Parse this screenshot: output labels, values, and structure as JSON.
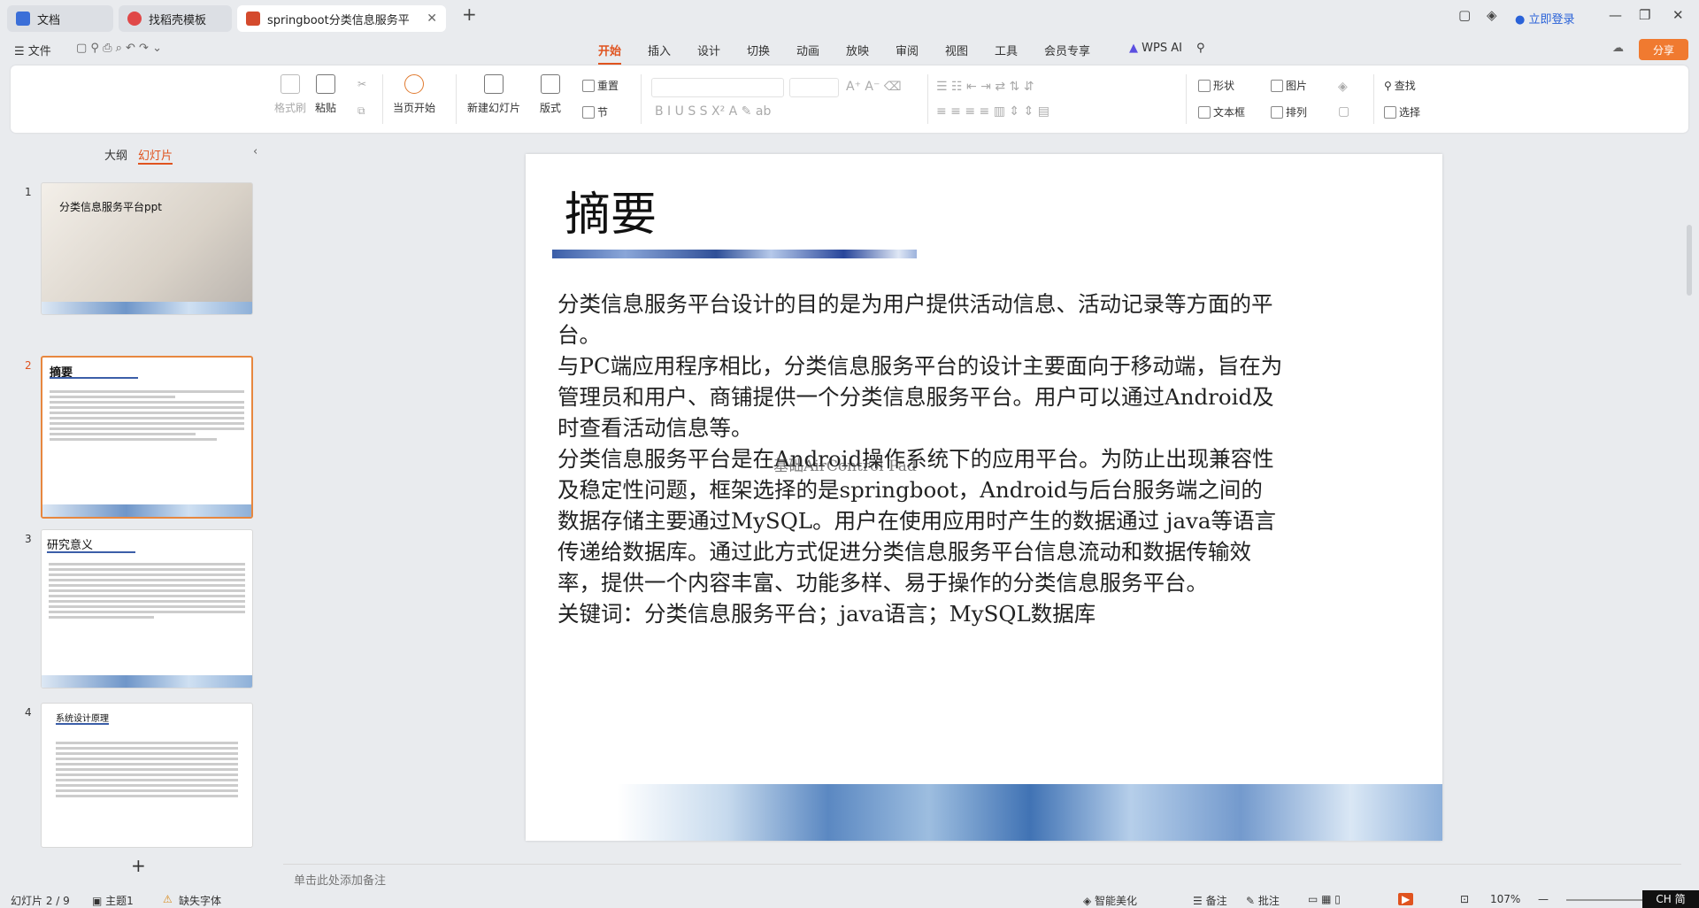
{
  "tabs": [
    {
      "label": "文档",
      "icon": "doc-icon"
    },
    {
      "label": "找稻壳模板",
      "icon": "template-icon"
    },
    {
      "label": "springboot分类信息服务平",
      "icon": "ppt-icon"
    }
  ],
  "window": {
    "login": "立即登录"
  },
  "menu": {
    "file": "文件",
    "items": [
      "开始",
      "插入",
      "设计",
      "切换",
      "动画",
      "放映",
      "审阅",
      "视图",
      "工具",
      "会员专享"
    ],
    "wps_ai": "WPS AI",
    "share": "分享"
  },
  "ribbon": {
    "format_painter": "格式刷",
    "paste": "粘贴",
    "start_show": "当页开始",
    "new_slide": "新建幻灯片",
    "layout": "版式",
    "reset": "重置",
    "section": "节",
    "shape": "形状",
    "picture": "图片",
    "find": "查找",
    "textbox": "文本框",
    "arrange": "排列",
    "select": "选择"
  },
  "panel": {
    "outline": "大纲",
    "slides": "幻灯片"
  },
  "thumbs": [
    {
      "num": "1",
      "title": "分类信息服务平台ppt"
    },
    {
      "num": "2",
      "title": "摘要"
    },
    {
      "num": "3",
      "title": "研究意义"
    },
    {
      "num": "4",
      "title": "系统设计原理"
    }
  ],
  "slide": {
    "title": "摘要",
    "paragraphs": [
      "分类信息服务平台设计的目的是为用户提供活动信息、活动记录等方面的平台。",
      "与PC端应用程序相比，分类信息服务平台的设计主要面向于移动端，旨在为管理员和用户、商铺提供一个分类信息服务平台。用户可以通过Android及时查看活动信息等。",
      "分类信息服务平台是在Android操作系统下的应用平台。为防止出现兼容性及稳定性问题，框架选择的是springboot，Android与后台服务端之间的数据存储主要通过MySQL。用户在使用应用时产生的数据通过 java等语言传递给数据库。通过此方式促进分类信息服务平台信息流动和数据传输效率，提供一个内容丰富、功能多样、易于操作的分类信息服务平台。",
      "关键词：分类信息服务平台；java语言；MySQL数据库"
    ],
    "overlay": "基础AirControl Pad"
  },
  "notes": {
    "placeholder": "单击此处添加备注"
  },
  "status": {
    "slide": "幻灯片 2 / 9",
    "theme": "主题1",
    "missing_font": "缺失字体",
    "beautify": "智能美化",
    "notes": "备注",
    "comment": "批注",
    "zoom": "107%",
    "ime": "CH 简"
  }
}
